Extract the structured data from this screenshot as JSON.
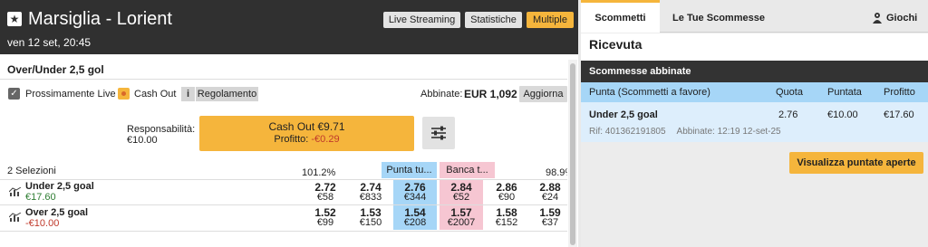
{
  "event": {
    "title": "Marsiglia - Lorient",
    "date": "ven 12 set, 20:45",
    "buttons": {
      "streaming": "Live Streaming",
      "stats": "Statistiche",
      "multiple": "Multiple"
    }
  },
  "market": {
    "name": "Over/Under 2,5 gol",
    "options": {
      "live_label": "Prossimamente Live",
      "cashout_label": "Cash Out",
      "info_glyph": "i",
      "rules_label": "Regolamento"
    },
    "matched": {
      "label": "Abbinate:",
      "value": "EUR 1,092"
    },
    "refresh_label": "Aggiorna",
    "liability": {
      "label": "Responsabilità:",
      "value": "€10.00"
    },
    "cashout": {
      "amount_text": "Cash Out €9.71",
      "profit_label": "Profitto:",
      "profit_value": "-€0.29"
    },
    "selections_count": "2 Selezioni",
    "back_pct": "101.2%",
    "lay_pct": "98.9%",
    "back_header": "Punta tu...",
    "lay_header": "Banca t...",
    "runners": [
      {
        "name": "Under 2,5 goal",
        "pl": "€17.60",
        "back": [
          {
            "odds": "2.72",
            "size": "€58"
          },
          {
            "odds": "2.74",
            "size": "€833"
          },
          {
            "odds": "2.76",
            "size": "€344"
          }
        ],
        "lay": [
          {
            "odds": "2.84",
            "size": "€52"
          },
          {
            "odds": "2.86",
            "size": "€90"
          },
          {
            "odds": "2.88",
            "size": "€24"
          }
        ]
      },
      {
        "name": "Over 2,5 goal",
        "pl": "-€10.00",
        "back": [
          {
            "odds": "1.52",
            "size": "€99"
          },
          {
            "odds": "1.53",
            "size": "€150"
          },
          {
            "odds": "1.54",
            "size": "€208"
          }
        ],
        "lay": [
          {
            "odds": "1.57",
            "size": "€2007"
          },
          {
            "odds": "1.58",
            "size": "€152"
          },
          {
            "odds": "1.59",
            "size": "€37"
          }
        ]
      }
    ]
  },
  "betslip": {
    "tabs": {
      "bets": "Scommetti",
      "my_bets": "Le Tue Scommesse",
      "games": "Giochi"
    },
    "receipt_title": "Ricevuta",
    "matched_bets_title": "Scommesse abbinate",
    "table_header": {
      "type": "Punta (Scommetti a favore)",
      "odds": "Quota",
      "stake": "Puntata",
      "profit": "Profitto"
    },
    "bet": {
      "selection": "Under 2,5 goal",
      "odds": "2.76",
      "stake": "€10.00",
      "profit": "€17.60",
      "ref": "Rif: 401362191805",
      "matched_at": "Abbinate: 12:19 12-set-25"
    },
    "view_open_label": "Visualizza puntate aperte"
  },
  "colors": {
    "accent": "#f5b53c",
    "back": "#a6d6f7",
    "lay": "#f6c6d2",
    "header_dark": "#303030",
    "profit_positive": "#2e7d32",
    "profit_negative": "#c0392b"
  },
  "icons": [
    "star-icon",
    "checkbox-icon",
    "cashout-icon",
    "info-icon",
    "sliders-icon",
    "chart-icon",
    "games-icon"
  ]
}
